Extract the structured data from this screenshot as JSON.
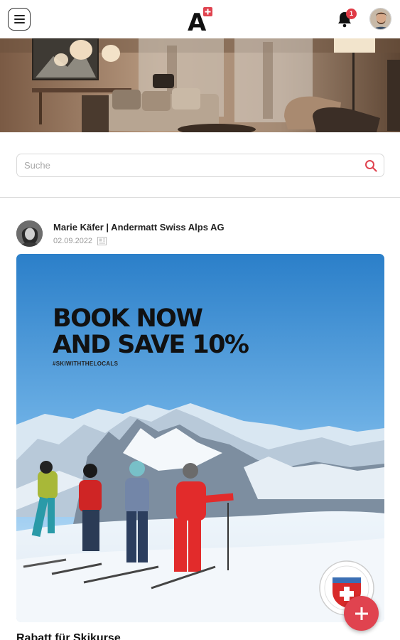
{
  "header": {
    "menu_icon": "hamburger-icon",
    "logo_letter": "A",
    "logo_cross": "+",
    "notification_icon": "bell-icon",
    "notification_count": "1",
    "user_avatar_icon": "user-avatar"
  },
  "search": {
    "placeholder": "Suche",
    "icon": "search-icon"
  },
  "post": {
    "author": "Marie Käfer | Andermatt Swiss Alps AG",
    "date": "02.09.2022",
    "meta_icon": "document-icon",
    "image_headline_line1": "BOOK NOW",
    "image_headline_line2": "AND SAVE 10%",
    "image_hashtag": "#SKIWITHTHELOCALS",
    "title": "Rabatt für Skikurse"
  },
  "fab": {
    "label": "+",
    "icon": "plus-icon"
  },
  "colors": {
    "accent": "#e0434f",
    "sky_top": "#2b7fc9",
    "text": "#222222"
  }
}
